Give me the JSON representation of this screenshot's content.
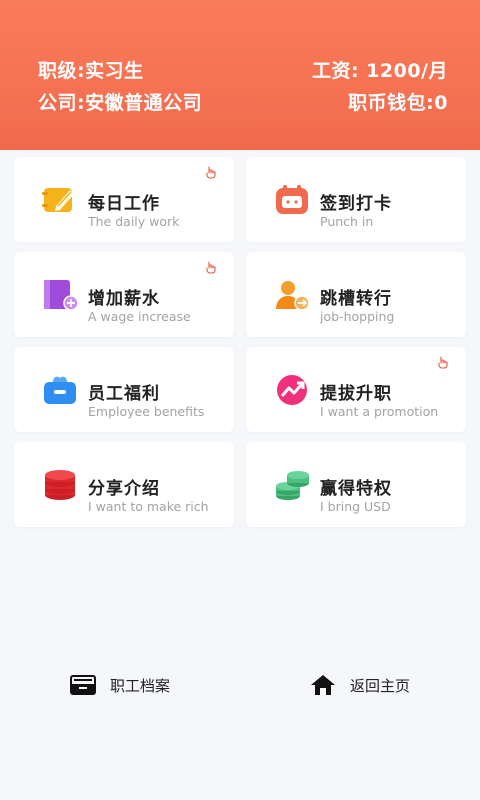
{
  "header": {
    "rank_label": "职级:实习生",
    "salary_label": "工资: 1200/月",
    "company_label": "公司:安徽普通公司",
    "wallet_label": "职币钱包:0",
    "bg_color": "#f26a4d"
  },
  "cards": [
    {
      "title": "每日工作",
      "subtitle": "The daily work",
      "icon": "notebook-pen-icon",
      "badge": "tap-icon"
    },
    {
      "title": "签到打卡",
      "subtitle": "Punch in",
      "icon": "calendar-icon"
    },
    {
      "title": "增加薪水",
      "subtitle": "A wage increase",
      "icon": "book-plus-icon",
      "badge": "tap-icon"
    },
    {
      "title": "跳槽转行",
      "subtitle": "job-hopping",
      "icon": "user-arrow-icon"
    },
    {
      "title": "员工福利",
      "subtitle": "Employee benefits",
      "icon": "gift-box-icon"
    },
    {
      "title": "提拔升职",
      "subtitle": "I want a promotion",
      "icon": "trend-up-icon",
      "badge": "tap-icon"
    },
    {
      "title": "分享介绍",
      "subtitle": "I want to make rich",
      "icon": "coin-stack-red-icon"
    },
    {
      "title": "赢得特权",
      "subtitle": "I bring USD",
      "icon": "coin-stack-green-icon"
    }
  ],
  "bottom_nav": {
    "archive_label": "职工档案",
    "home_label": "返回主页"
  }
}
